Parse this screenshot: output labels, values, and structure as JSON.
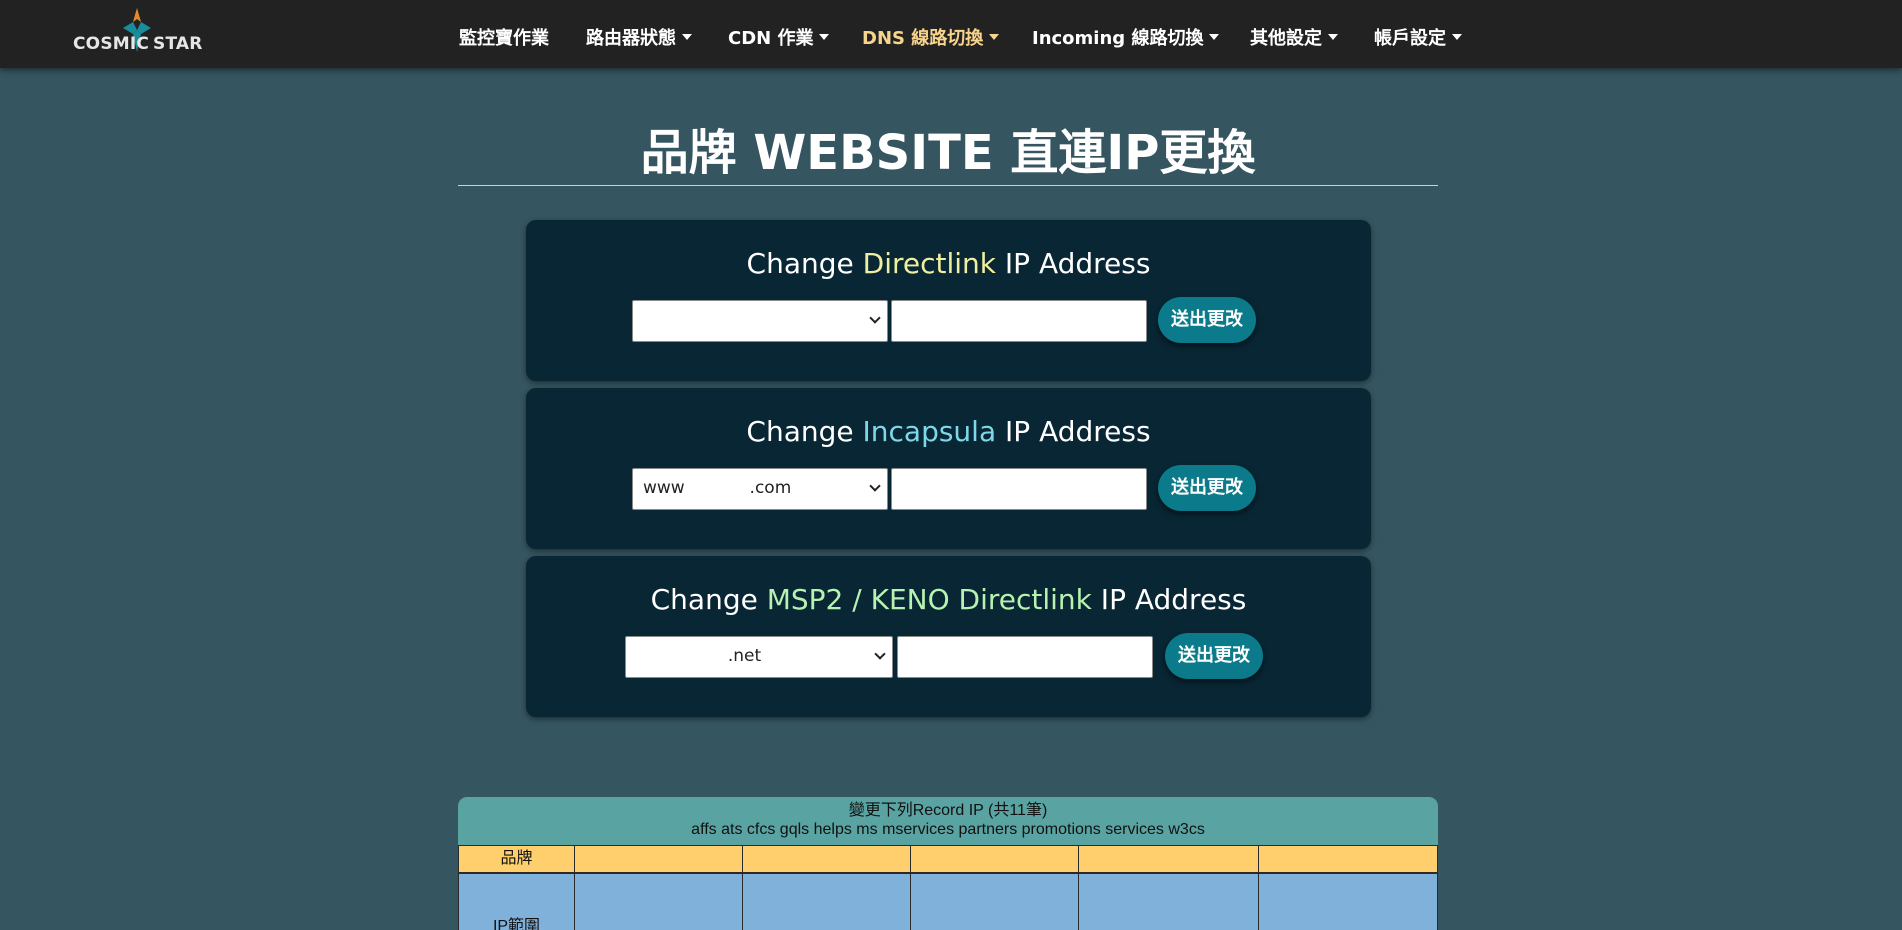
{
  "brand": {
    "logo_left": "COSMIC",
    "logo_right": "STAR"
  },
  "nav": {
    "items": [
      {
        "label": "監控寶作業",
        "dropdown": false,
        "active": false
      },
      {
        "label": "路由器狀態",
        "dropdown": true,
        "active": false
      },
      {
        "label": "CDN 作業",
        "dropdown": true,
        "active": false
      },
      {
        "label": "DNS 線路切換",
        "dropdown": true,
        "active": true
      },
      {
        "label": "Incoming 線路切換",
        "dropdown": true,
        "active": false
      },
      {
        "label": "其他設定",
        "dropdown": true,
        "active": false
      },
      {
        "label": "帳戶設定",
        "dropdown": true,
        "active": false
      }
    ]
  },
  "page": {
    "title": "品牌 WEBSITE 直連IP更換"
  },
  "panels": [
    {
      "prefix": "Change ",
      "highlight": "Directlink",
      "suffix": " IP Address",
      "select_value": "",
      "input_value": "",
      "button_label": "送出更改"
    },
    {
      "prefix": "Change ",
      "highlight": "Incapsula",
      "suffix": " IP Address",
      "select_value": "www            .com",
      "input_value": "",
      "button_label": "送出更改"
    },
    {
      "prefix": "Change ",
      "highlight": "MSP2 / KENO Directlink",
      "suffix": " IP Address",
      "select_value": "                 .net",
      "input_value": "",
      "button_label": "送出更改"
    }
  ],
  "record_table": {
    "header_line1": "變更下列Record IP (共11筆)",
    "header_line2": "affs ats cfcs gqls helps ms mservices partners promotions services w3cs",
    "row_brand_label": "品牌",
    "row_ip_label": "IP範圍",
    "brand_cells": [
      "",
      "",
      "",
      "",
      ""
    ],
    "ip_cells": [
      "",
      "",
      "",
      "",
      ""
    ]
  },
  "colors": {
    "navbar": "#222222",
    "page_bg": "#355560",
    "panel_bg": "#082633",
    "active_nav": "#f7d48c",
    "button": "#0b7a8a",
    "table_header": "#5aa3a3",
    "brand_row": "#ffce6d",
    "ip_row": "#80b1db"
  }
}
